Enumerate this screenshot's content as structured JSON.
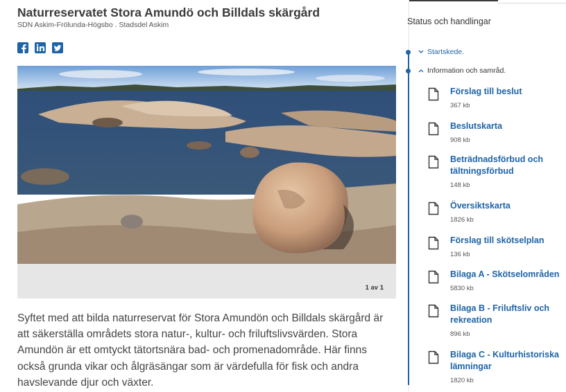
{
  "page": {
    "title": "Naturreservatet Stora Amundö och Billdals skärgård",
    "subtitle": "SDN Askim-Frölunda-Högsbo . Stadsdel Askim",
    "share_icons": [
      "facebook-icon",
      "linkedin-icon",
      "twitter-icon"
    ]
  },
  "gallery": {
    "counter": "1 av 1"
  },
  "description": "Syftet med att bilda naturreservat för Stora Amundön och Billdals skärgård är att säkerställa områdets stora natur-, kultur- och friluftslivsvärden. Stora Amundön är ett omtyckt tätortsnära bad- och promenadområde. Här finns också grunda vikar och ålgräsängar som är värdefulla för fisk och andra havslevande djur och växter.",
  "sidebar": {
    "title": "Status och handlingar",
    "stages": [
      {
        "label": "Startskede.",
        "expanded": false
      },
      {
        "label": "Information och samråd.",
        "expanded": true
      }
    ],
    "documents": [
      {
        "name": "Förslag till beslut",
        "size": "367 kb"
      },
      {
        "name": "Beslutskarta",
        "size": "908 kb"
      },
      {
        "name": "Beträdnadsförbud och tältningsförbud",
        "size": "148 kb"
      },
      {
        "name": "Översiktskarta",
        "size": "1826 kb"
      },
      {
        "name": "Förslag till skötselplan",
        "size": "136 kb"
      },
      {
        "name": "Bilaga A - Skötselområden",
        "size": "5830 kb"
      },
      {
        "name": "Bilaga B - Friluftsliv och rekreation",
        "size": "896 kb"
      },
      {
        "name": "Bilaga C - Kulturhistoriska lämningar",
        "size": "1820 kb"
      }
    ]
  },
  "colors": {
    "accent": "#1d63a6",
    "text": "#333333",
    "caption_bg": "#e6e6e6"
  }
}
